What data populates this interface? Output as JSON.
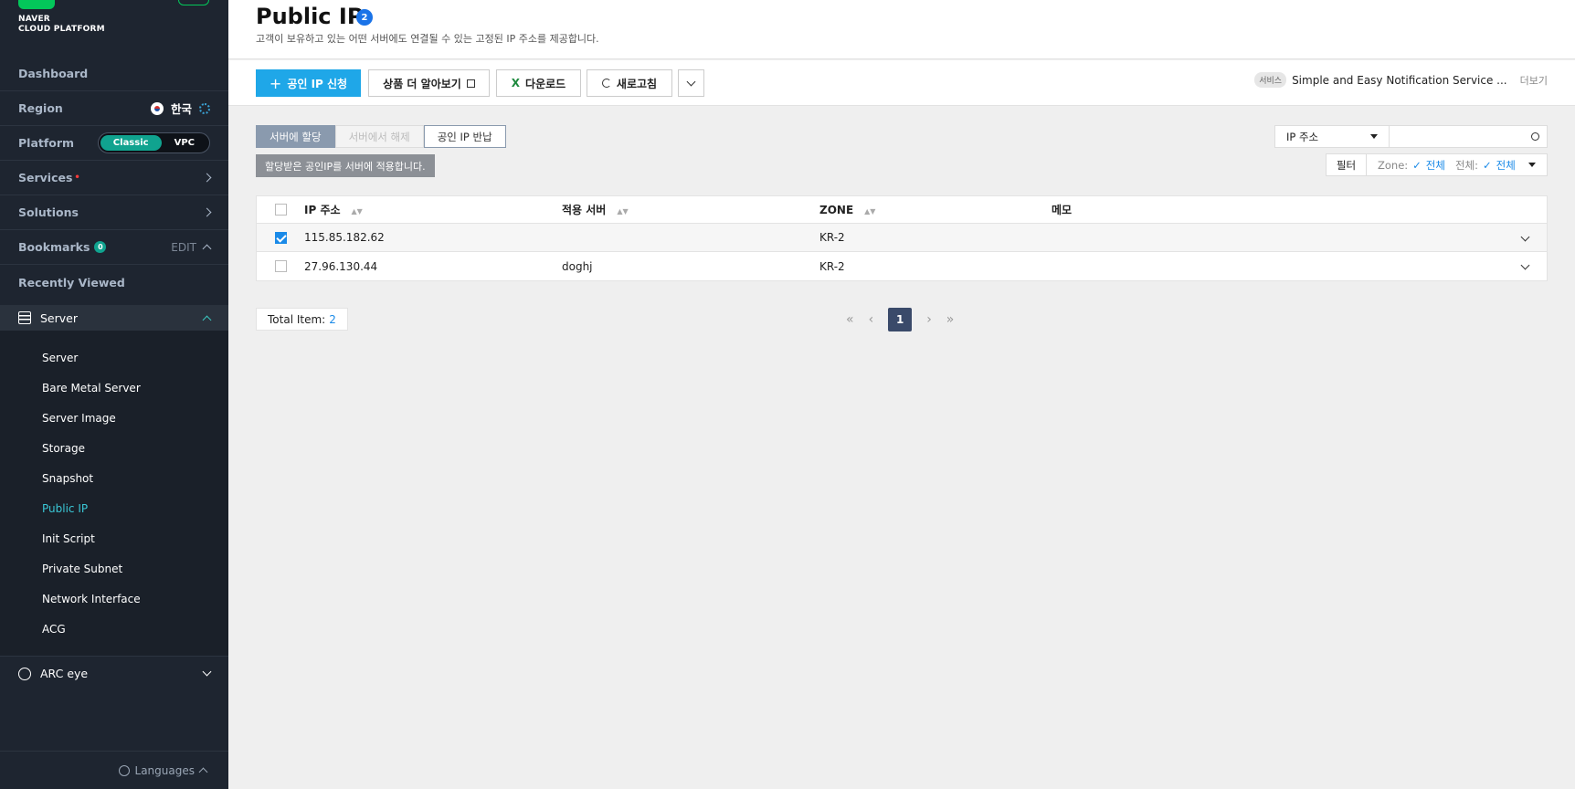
{
  "brand": {
    "line1": "NAVER",
    "line2": "CLOUD PLATFORM"
  },
  "sidebar": {
    "dashboard": "Dashboard",
    "region": {
      "label": "Region",
      "value": "한국"
    },
    "platform": {
      "label": "Platform",
      "options": [
        "Classic",
        "VPC"
      ],
      "selected": "Classic"
    },
    "services": "Services",
    "solutions": "Solutions",
    "bookmarks": {
      "label": "Bookmarks",
      "count": "0",
      "edit": "EDIT"
    },
    "recently_viewed": "Recently Viewed",
    "server_group": "Server",
    "server_items": [
      "Server",
      "Bare Metal Server",
      "Server Image",
      "Storage",
      "Snapshot",
      "Public IP",
      "Init Script",
      "Private Subnet",
      "Network Interface",
      "ACG"
    ],
    "active_item": "Public IP",
    "arc_eye": "ARC eye",
    "languages": "Languages"
  },
  "page": {
    "title": "Public IP",
    "count": "2",
    "subtitle": "고객이 보유하고 있는 어떤 서버에도 연결될 수 있는 고정된 IP 주소를 제공합니다."
  },
  "toolbar": {
    "apply": "공인 IP 신청",
    "learn_more": "상품 더 알아보기",
    "download": "다운로드",
    "refresh": "새로고침"
  },
  "service_notice": {
    "tag": "서비스",
    "text": "Simple and Easy Notification Service ...",
    "more": "더보기"
  },
  "actions": {
    "assign": "서버에 할당",
    "unassign": "서버에서 해제",
    "return": "공인 IP 반납"
  },
  "tooltip": "할당받은 공인IP를 서버에 적용합니다.",
  "search": {
    "field": "IP 주소",
    "value": ""
  },
  "filter": {
    "label": "필터",
    "zone_label": "Zone:",
    "zone_value": "전체",
    "all_label": "전체:",
    "all_value": "전체"
  },
  "table": {
    "columns": [
      "IP 주소",
      "적용 서버",
      "ZONE",
      "메모"
    ],
    "rows": [
      {
        "ip": "115.85.182.62",
        "server": "",
        "zone": "KR-2",
        "memo": "",
        "checked": true
      },
      {
        "ip": "27.96.130.44",
        "server": "doghj",
        "zone": "KR-2",
        "memo": "",
        "checked": false
      }
    ]
  },
  "footer": {
    "total_label": "Total Item:",
    "total_value": "2",
    "current_page": "1"
  }
}
